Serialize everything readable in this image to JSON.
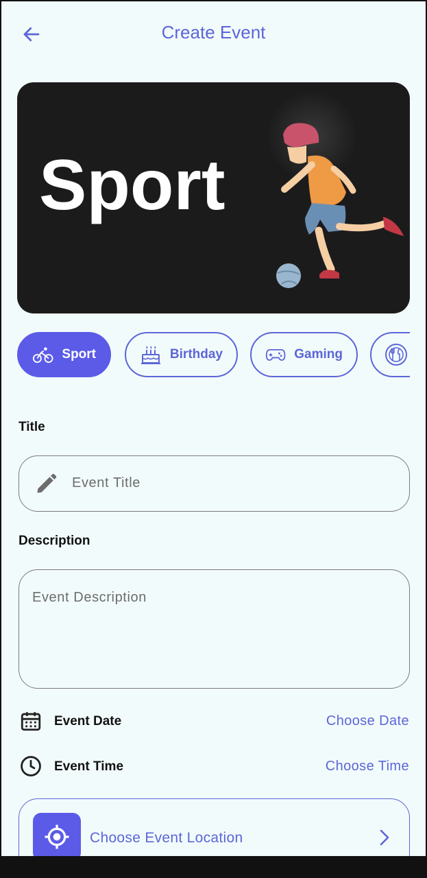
{
  "header": {
    "title": "Create Event",
    "back_icon": "arrow-left-icon"
  },
  "banner": {
    "text": "Sport",
    "illustration": "boy-kicking-ball-illustration"
  },
  "categories": [
    {
      "label": "Sport",
      "icon": "bicycle-icon",
      "selected": true
    },
    {
      "label": "Birthday",
      "icon": "cake-icon",
      "selected": false
    },
    {
      "label": "Gaming",
      "icon": "gamepad-icon",
      "selected": false
    },
    {
      "label": "",
      "icon": "dining-icon",
      "selected": false
    }
  ],
  "form": {
    "title_label": "Title",
    "title_placeholder": "Event Title",
    "description_label": "Description",
    "description_placeholder": "Event Description",
    "date_label": "Event Date",
    "date_action": "Choose Date",
    "time_label": "Event Time",
    "time_action": "Choose Time",
    "location_action": "Choose Event Location"
  },
  "colors": {
    "accent": "#5b5be8",
    "accent_text": "#5b66d8",
    "background": "#f2fbfb",
    "banner": "#1c1b1c"
  }
}
